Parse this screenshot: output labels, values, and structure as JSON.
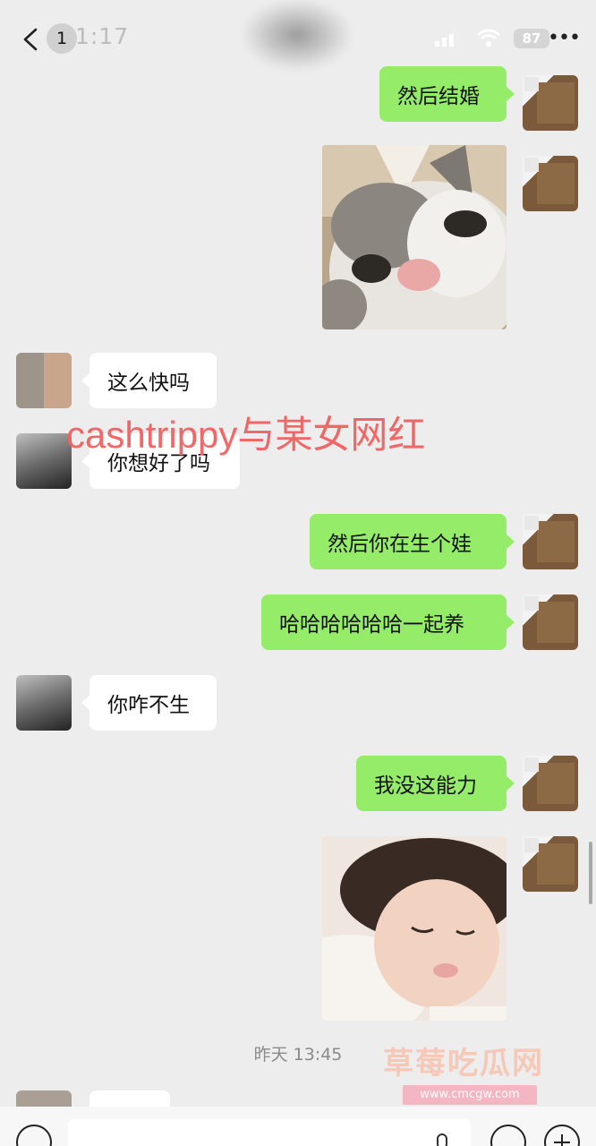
{
  "status_bar": {
    "time": "1:17",
    "battery": "87",
    "unread_count": "1"
  },
  "icons": {
    "back": "chevron-left-icon",
    "more": "ellipsis-icon",
    "signal": "signal-icon",
    "wifi": "wifi-icon",
    "voice": "voice-icon",
    "mic": "mic-icon",
    "emoji": "emoji-icon",
    "plus": "plus-icon"
  },
  "colors": {
    "outgoing_bubble": "#95ec69",
    "incoming_bubble": "#ffffff",
    "background": "#ededed",
    "watermark": "#f06060"
  },
  "messages": [
    {
      "from": "me",
      "type": "text",
      "text": "然后结婚"
    },
    {
      "from": "me",
      "type": "image",
      "subject": "cat"
    },
    {
      "from": "them",
      "type": "text",
      "text": "这么快吗"
    },
    {
      "from": "them",
      "type": "text",
      "text": "你想好了吗"
    },
    {
      "from": "me",
      "type": "text",
      "text": "然后你在生个娃"
    },
    {
      "from": "me",
      "type": "text",
      "text": "哈哈哈哈哈哈一起养"
    },
    {
      "from": "them",
      "type": "text",
      "text": "你咋不生"
    },
    {
      "from": "me",
      "type": "text",
      "text": "我没这能力"
    },
    {
      "from": "me",
      "type": "image",
      "subject": "child"
    }
  ],
  "timestamp": "昨天 13:45",
  "overlay": {
    "caption": "cashtrippy与某女网红",
    "logo_text": "草莓吃瓜网",
    "logo_url": "www.cmcgw.com"
  }
}
